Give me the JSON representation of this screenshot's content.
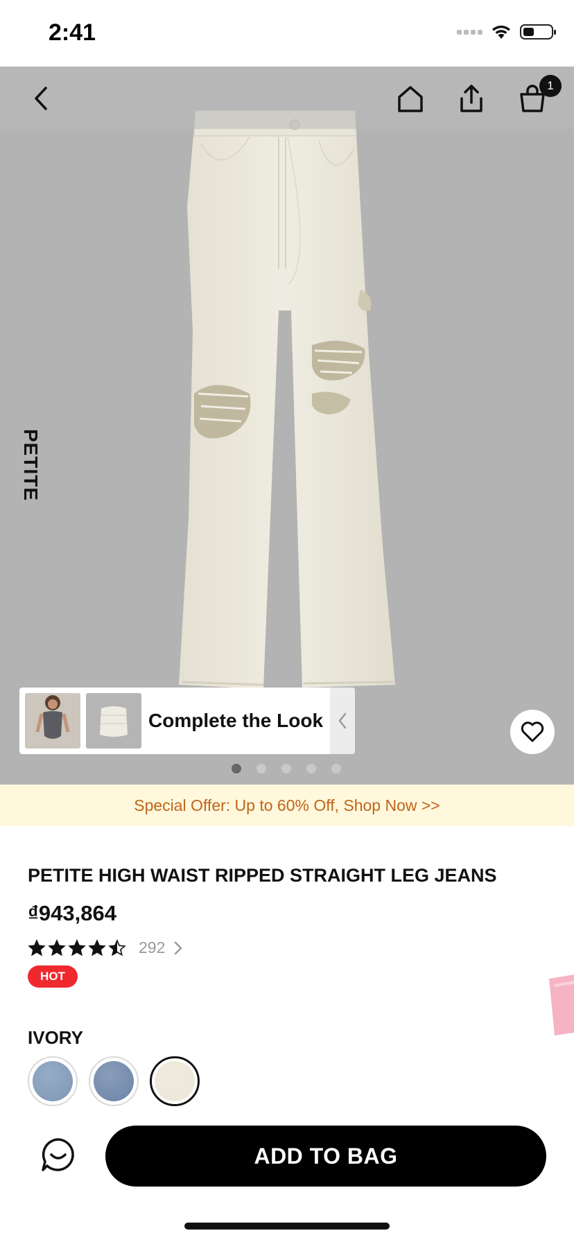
{
  "status_bar": {
    "time": "2:41",
    "battery_level": 0.4
  },
  "topbar": {
    "icons": [
      "back-icon",
      "home-icon",
      "share-icon",
      "shopping-bag-icon"
    ],
    "cart_count": "1"
  },
  "hero": {
    "side_label": "PETITE",
    "complete_the_look": "Complete the Look",
    "image_count": 5,
    "active_image_index": 0
  },
  "promo": {
    "text": "Special Offer: Up to 60% Off, Shop Now >>"
  },
  "product": {
    "title": "PETITE HIGH WAIST RIPPED STRAIGHT LEG JEANS",
    "price": "₫943,864",
    "rating": 4.5,
    "review_count": "292",
    "badge": "HOT"
  },
  "color": {
    "selected_label": "IVORY",
    "swatches": [
      {
        "name": "light-blue-denim",
        "color": "#7d97b6"
      },
      {
        "name": "medium-blue-denim",
        "color": "#6c84a8"
      },
      {
        "name": "ivory",
        "color": "#ebe6d7"
      }
    ]
  },
  "actions": {
    "add_to_bag": "ADD TO BAG"
  },
  "colors": {
    "hero_bg": "#b3b3b3",
    "promo_bg": "#fff8dc",
    "promo_text": "#c0651b",
    "badge_red": "#f0292f",
    "cta_bg": "#000000"
  }
}
